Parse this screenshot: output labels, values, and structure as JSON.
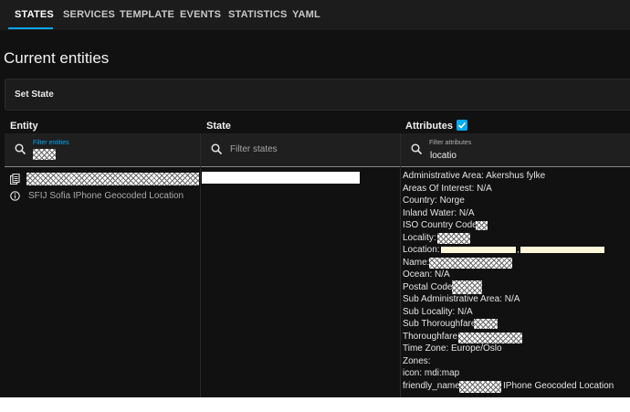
{
  "tabs": [
    {
      "label": "STATES",
      "active": true
    },
    {
      "label": "SERVICES",
      "active": false
    },
    {
      "label": "TEMPLATE",
      "active": false
    },
    {
      "label": "EVENTS",
      "active": false
    },
    {
      "label": "STATISTICS",
      "active": false
    },
    {
      "label": "YAML",
      "active": false
    }
  ],
  "page_title": "Current entities",
  "set_state_label": "Set State",
  "columns": {
    "entity": "Entity",
    "state": "State",
    "attributes": "Attributes",
    "attributes_checked": true
  },
  "filters": {
    "entity_label": "Filter entities",
    "state_placeholder": "Filter states",
    "attributes_label": "Filter attributes",
    "attributes_value": "locatio"
  },
  "entity": {
    "name": "SFIJ Sofia IPhone Geocoded Location",
    "copy_icon": "clipboard-icon",
    "info_icon": "info-icon"
  },
  "attributes": {
    "administrative_area": "Administrative Area: Akershus fylke",
    "areas_of_interest": "Areas Of Interest: N/A",
    "country": "Country: Norge",
    "inland_water": "Inland Water: N/A",
    "iso_country_code": "ISO Country Code:",
    "locality": "Locality:",
    "location": "Location:",
    "location_sep": ",",
    "name": "Name:",
    "ocean": "Ocean: N/A",
    "postal_code": "Postal Code:",
    "sub_administrative_area": "Sub Administrative Area: N/A",
    "sub_locality": "Sub Locality: N/A",
    "sub_thoroughfare": "Sub Thoroughfare:",
    "thoroughfare": "Thoroughfare:",
    "time_zone": "Time Zone: Europe/Oslo",
    "zones": "Zones:",
    "icon": "icon: mdi:map",
    "friendly_name_prefix": "friendly_name:",
    "friendly_name_suffix": "IPhone Geocoded Location"
  },
  "colors": {
    "accent": "#03a9f4",
    "background": "#111111",
    "panel": "#1c1c1c"
  }
}
